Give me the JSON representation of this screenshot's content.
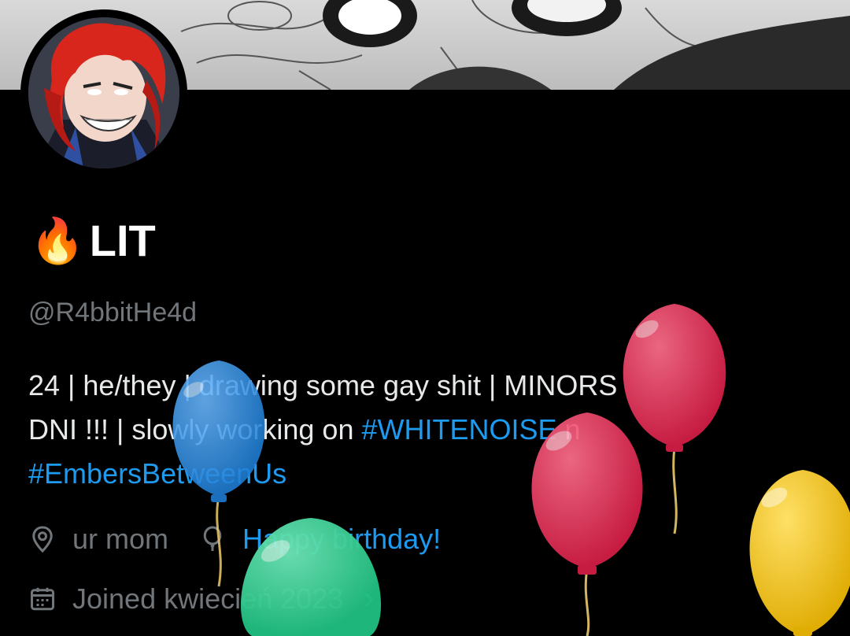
{
  "profile": {
    "name_emoji": "🔥",
    "display_name": "LIT",
    "handle": "@R4bbitHe4d",
    "bio": {
      "line1": "24 | he/they | drawing some gay shit | MINORS",
      "line2_prefix": "DNI !!! | slowly working on ",
      "hashtag1": "#WHITENOISE",
      "line2_suffix": " n",
      "hashtag2": "#EmbersBetweenUs"
    },
    "location": "ur mom",
    "birthday": "Happy birthday!",
    "joined": "Joined kwiecień 2023",
    "joined_chevron": "›"
  },
  "icons": {
    "location": "location-pin-icon",
    "birthday": "balloon-icon",
    "calendar": "calendar-icon",
    "chevron": "chevron-right-icon"
  },
  "colors": {
    "background": "#000000",
    "text_primary": "#e7e9ea",
    "text_secondary": "#71767b",
    "accent": "#1d9bf0",
    "balloon_red": "#e0284f",
    "balloon_blue": "#2a8ee8",
    "balloon_green": "#27c98a",
    "balloon_yellow": "#e9b90c"
  }
}
